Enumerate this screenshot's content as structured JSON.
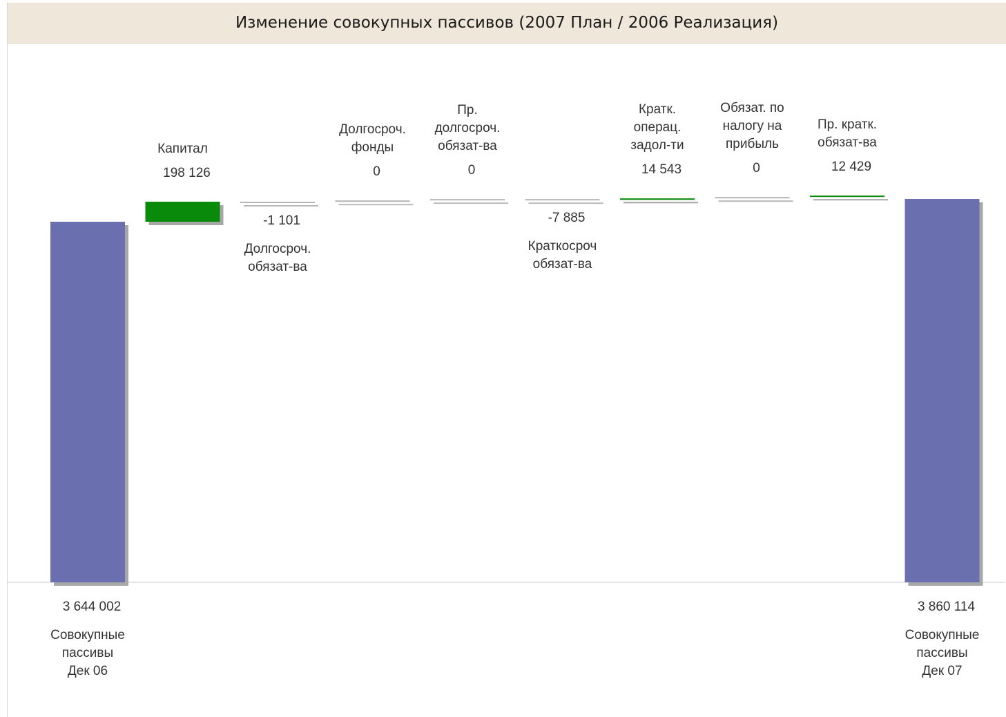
{
  "chart_data": {
    "type": "waterfall",
    "title": "Изменение совокупных пассивов (2007 План / 2006 Реализация)",
    "baseline": 0,
    "colors": {
      "total": "#6a6faf",
      "increase": "#0a8a0a",
      "decrease": "#b5b5b5",
      "shadow": "#a7a7a7",
      "axis": "#c8c8c8"
    },
    "steps": [
      {
        "kind": "total",
        "value": 3644002,
        "value_label": "3 644 002",
        "label": [
          "Совокупные",
          "пассивы",
          "Дек 06"
        ]
      },
      {
        "kind": "delta",
        "value": 198126,
        "value_label": "198 126",
        "label": [
          "Капитал"
        ]
      },
      {
        "kind": "delta",
        "value": -1101,
        "value_label": "-1 101",
        "label": [
          "Долгосроч.",
          "обязат-ва"
        ]
      },
      {
        "kind": "delta",
        "value": 0,
        "value_label": "0",
        "label": [
          "Долгосроч.",
          "фонды"
        ]
      },
      {
        "kind": "delta",
        "value": 0,
        "value_label": "0",
        "label": [
          "Пр.",
          "долгосроч.",
          "обязат-ва"
        ]
      },
      {
        "kind": "delta",
        "value": -7885,
        "value_label": "-7 885",
        "label": [
          "Краткосроч",
          "обязат-ва"
        ]
      },
      {
        "kind": "delta",
        "value": 14543,
        "value_label": "14 543",
        "label": [
          "Кратк.",
          "операц.",
          "задол-ти"
        ]
      },
      {
        "kind": "delta",
        "value": 0,
        "value_label": "0",
        "label": [
          "Обязат. по",
          "налогу на",
          "прибыль"
        ]
      },
      {
        "kind": "delta",
        "value": 12429,
        "value_label": "12 429",
        "label": [
          "Пр. кратк.",
          "обязат-ва"
        ]
      },
      {
        "kind": "total",
        "value": 3860114,
        "value_label": "3 860 114",
        "label": [
          "Совокупные",
          "пассивы",
          "Дек 07"
        ]
      }
    ]
  }
}
